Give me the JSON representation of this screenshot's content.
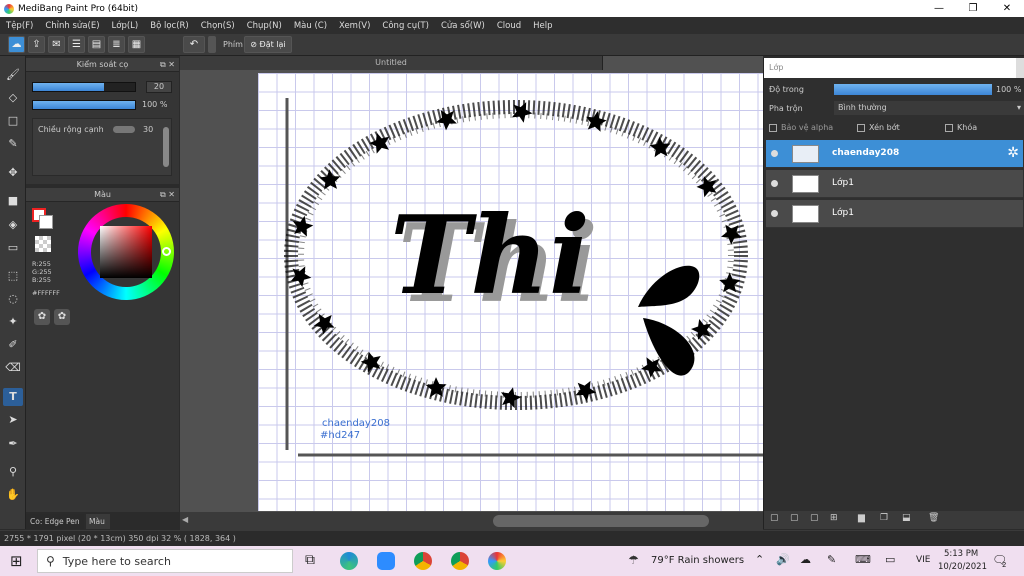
{
  "window": {
    "title": "MediBang Paint Pro (64bit)",
    "min": "—",
    "max": "❐",
    "close": "✕"
  },
  "menu": [
    "Tệp(F)",
    "Chỉnh sửa(E)",
    "Lớp(L)",
    "Bộ lọc(R)",
    "Chọn(S)",
    "Chụp(N)",
    "Màu (C)",
    "Xem(V)",
    "Công cụ(T)",
    "Cửa sổ(W)",
    "Cloud",
    "Help"
  ],
  "toolbar": {
    "shortcut_label": "Phím",
    "reset_label": "Đặt lại"
  },
  "brush_panel": {
    "title": "Kiểm soát cọ",
    "size": "20",
    "opacity": "100 %",
    "size_fill": 0.7,
    "opacity_fill": 1.0,
    "edge_label": "Chiều rộng cạnh",
    "edge_value": "30"
  },
  "color_panel": {
    "title": "Màu",
    "r": "R:255",
    "g": "G:255",
    "b": "B:255",
    "hex": "#FFFFFF"
  },
  "document": {
    "tab": "Untitled",
    "art_text": "Thi",
    "signature1": "chaenday208",
    "signature2": "#hd247"
  },
  "layer_panel": {
    "title": "Lớp",
    "opacity_label": "Độ trong",
    "opacity_value": "100 %",
    "opacity_fill": 1.0,
    "blend_label": "Pha trộn",
    "blend_value": "Bình thường",
    "protect_alpha": "Bảo vệ alpha",
    "clip": "Xén bớt",
    "lock": "Khóa",
    "layers": [
      {
        "name": "chaenday208",
        "selected": true
      },
      {
        "name": "Lớp1",
        "selected": false
      },
      {
        "name": "Lớp1",
        "selected": false
      }
    ]
  },
  "bottom_tabs": {
    "brush_name": "Co: Edge Pen",
    "color_tab": "Màu"
  },
  "status": {
    "text": "2755 * 1791 pixel  (20 * 13cm)  350 dpi  32 %  ( 1828, 364 )"
  },
  "taskbar": {
    "search_placeholder": "Type here to search",
    "weather": "79°F  Rain showers",
    "lang": "VIE",
    "time": "5:13 PM",
    "date": "10/20/2021",
    "notifications": "2"
  },
  "colors": {
    "accent": "#3d8fd6",
    "panel": "#353535",
    "taskbar": "#f0dff0"
  }
}
